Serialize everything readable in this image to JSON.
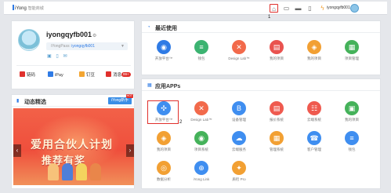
{
  "topbar": {
    "brand_main": "iYong",
    "brand_sub": "智能商城",
    "annotation_1": "1",
    "username": "iyongqyfb001",
    "icons": [
      "home-icon",
      "monitor-icon",
      "folder-icon",
      "book-icon",
      "flash-icon"
    ]
  },
  "profile": {
    "username": "iyongqyfb001",
    "gear_symbol": "⚙",
    "pass_label": "iYongPass:",
    "pass_value": "iyongqyfb001",
    "stats": [
      {
        "icon": "link-icon",
        "label": "链码",
        "color": "#e0302c"
      },
      {
        "icon": "ipay-icon",
        "label": "iPay",
        "color": "#2f7be5"
      },
      {
        "icon": "coin-icon",
        "label": "钉豆",
        "color": "#f3a531"
      },
      {
        "icon": "message-icon",
        "label": "消息",
        "badge": "99+",
        "color": "#e0302c"
      }
    ]
  },
  "news": {
    "title": "动态精选",
    "tag": "iYong新手",
    "tag_hot": "HOT",
    "banner_line1": "爱用合伙人计划",
    "banner_line2": "推荐有奖",
    "prev": "‹",
    "next": "›"
  },
  "recent": {
    "title": "最近使用",
    "apps": [
      {
        "label": "开放平台™",
        "color": "#2f7be5",
        "glyph": "◉"
      },
      {
        "label": "钱包",
        "color": "#3cb371",
        "glyph": "≡"
      },
      {
        "label": "Design Lab™",
        "color": "#f26a4b",
        "glyph": "✕"
      },
      {
        "label": "我的项目",
        "color": "#e9534f",
        "glyph": "▤"
      },
      {
        "label": "我的项目",
        "color": "#f2a033",
        "glyph": "◈"
      },
      {
        "label": "项目管理",
        "color": "#45b25a",
        "glyph": "▦"
      }
    ]
  },
  "apps": {
    "title": "应用APPs",
    "annotation_2": "2",
    "items": [
      {
        "label": "开放平台™",
        "color": "#3f8ef0",
        "glyph": "✣"
      },
      {
        "label": "Design Lab™",
        "color": "#f26a4b",
        "glyph": "✕"
      },
      {
        "label": "设备管理",
        "color": "#3f8ef0",
        "glyph": "B"
      },
      {
        "label": "报价系统",
        "color": "#ef5a4f",
        "glyph": "▤"
      },
      {
        "label": "云端系统",
        "color": "#ef5a4f",
        "glyph": "☷"
      },
      {
        "label": "我的项目",
        "color": "#45b25a",
        "glyph": "▣"
      },
      {
        "label": "我的项目",
        "color": "#f2a033",
        "glyph": "◈"
      },
      {
        "label": "项目系统",
        "color": "#45b25a",
        "glyph": "◉"
      },
      {
        "label": "云端服务",
        "color": "#3f8ef0",
        "glyph": "☁"
      },
      {
        "label": "管理系统",
        "color": "#f2a033",
        "glyph": "▦"
      },
      {
        "label": "客户管理",
        "color": "#3f8ef0",
        "glyph": "☎"
      },
      {
        "label": "钱包",
        "color": "#3f8ef0",
        "glyph": "≡"
      },
      {
        "label": "数据分析",
        "color": "#f2a033",
        "glyph": "◎"
      },
      {
        "label": "iYong Link",
        "color": "#3f8ef0",
        "glyph": "⊕"
      },
      {
        "label": "质检 Pro",
        "color": "#f2a033",
        "glyph": "✦"
      }
    ]
  }
}
